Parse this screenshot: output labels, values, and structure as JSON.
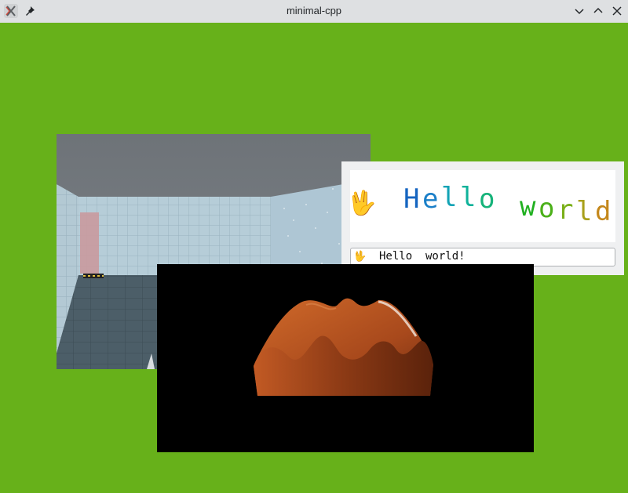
{
  "window": {
    "title": "minimal-cpp"
  },
  "canvas": {
    "background": "#67b11a"
  },
  "hello_widget": {
    "emoji": "🖖",
    "banner_chars": [
      "H",
      "e",
      "l",
      "l",
      "o",
      "w",
      "o",
      "r",
      "l",
      "d",
      "!"
    ],
    "banner_colors": [
      "#1565c0",
      "#1a7fc8",
      "#12a3b5",
      "#0fb29a",
      "#16b37a",
      "#20b020",
      "#4bb019",
      "#7bb01a",
      "#a8a01a",
      "#c4871a",
      "#d05b19"
    ],
    "field_value": "Hello  world!"
  },
  "surface": {
    "color": "#a8491c"
  }
}
